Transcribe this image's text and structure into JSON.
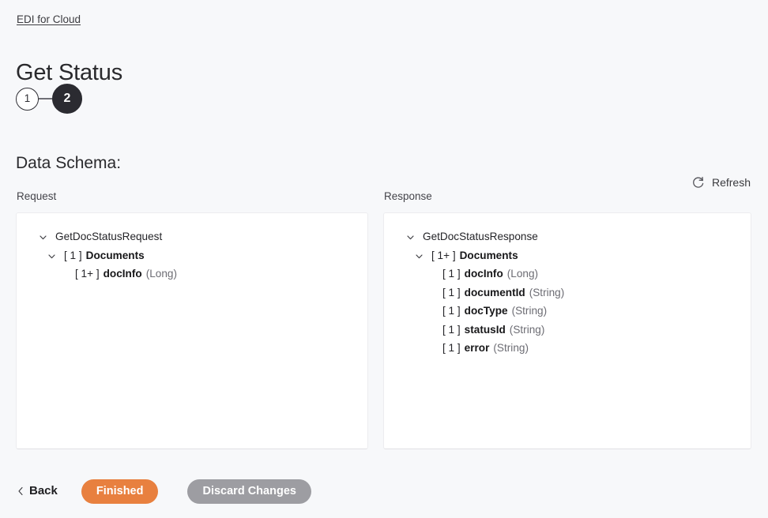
{
  "breadcrumb": {
    "label": "EDI for Cloud"
  },
  "page": {
    "title": "Get Status"
  },
  "stepper": {
    "steps": [
      {
        "label": "1",
        "state": "inactive"
      },
      {
        "label": "2",
        "state": "active"
      }
    ]
  },
  "section": {
    "heading": "Data Schema:"
  },
  "toolbar": {
    "refresh_label": "Refresh",
    "refresh_icon": "refresh-icon"
  },
  "schema": {
    "request": {
      "column_label": "Request",
      "nodes": [
        {
          "depth": 0,
          "caret": "chevron-down-icon",
          "card": "",
          "name": "GetDocStatusRequest",
          "bold": false,
          "type": ""
        },
        {
          "depth": 1,
          "caret": "chevron-down-icon",
          "card": "[ 1 ]",
          "name": "Documents",
          "bold": true,
          "type": ""
        },
        {
          "depth": 2,
          "caret": "",
          "card": "[ 1+ ]",
          "name": "docInfo",
          "bold": true,
          "type": "(Long)"
        }
      ]
    },
    "response": {
      "column_label": "Response",
      "nodes": [
        {
          "depth": 0,
          "caret": "chevron-down-icon",
          "card": "",
          "name": "GetDocStatusResponse",
          "bold": false,
          "type": ""
        },
        {
          "depth": 1,
          "caret": "chevron-down-icon",
          "card": "[ 1+ ]",
          "name": "Documents",
          "bold": true,
          "type": ""
        },
        {
          "depth": 2,
          "caret": "",
          "card": "[ 1 ]",
          "name": "docInfo",
          "bold": true,
          "type": "(Long)"
        },
        {
          "depth": 2,
          "caret": "",
          "card": "[ 1 ]",
          "name": "documentId",
          "bold": true,
          "type": "(String)"
        },
        {
          "depth": 2,
          "caret": "",
          "card": "[ 1 ]",
          "name": "docType",
          "bold": true,
          "type": "(String)"
        },
        {
          "depth": 2,
          "caret": "",
          "card": "[ 1 ]",
          "name": "statusId",
          "bold": true,
          "type": "(String)"
        },
        {
          "depth": 2,
          "caret": "",
          "card": "[ 1 ]",
          "name": "error",
          "bold": true,
          "type": "(String)"
        }
      ]
    }
  },
  "footer": {
    "back_label": "Back",
    "back_icon": "chevron-left-icon",
    "finished_label": "Finished",
    "discard_label": "Discard Changes"
  },
  "colors": {
    "background": "#f7f8fa",
    "panel": "#ffffff",
    "primary_button": "#e8803f",
    "secondary_button": "#9d9da2",
    "step_active": "#2b2b31",
    "text": "#242428"
  }
}
